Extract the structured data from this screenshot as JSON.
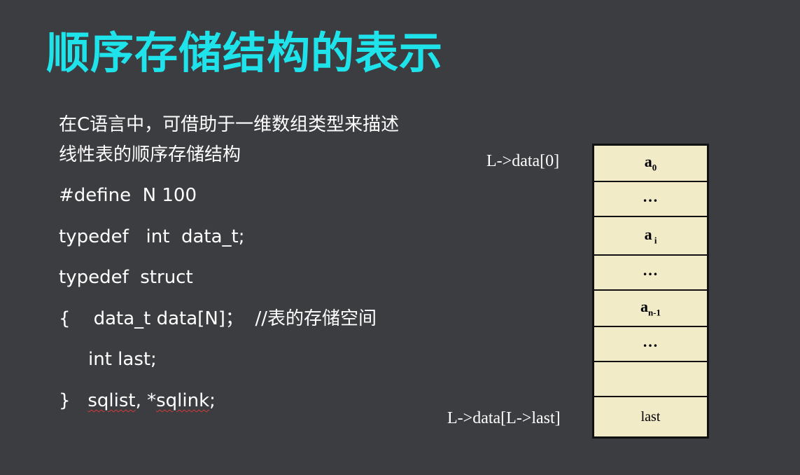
{
  "slide": {
    "title": "顺序存储结构的表示",
    "code_lines": [
      "在C语言中，可借助于一维数组类型来描述",
      "线性表的顺序存储结构",
      "#define  N 100",
      "typedef   int  data_t;",
      "typedef  struct",
      "{    data_t data[N]；  //表的存储空间",
      "int last;",
      "}"
    ],
    "last_line_tail": {
      "sep": "   ",
      "word1": "sqlist",
      "mid": ", *",
      "word2": "sqlink",
      "end": ";"
    }
  },
  "diagram": {
    "label_top": "L->data[0]",
    "label_bottom": "L->data[L->last]",
    "cells": [
      {
        "base": "a",
        "sub": "0"
      },
      {
        "text": "…"
      },
      {
        "base": "a",
        "sub": " i"
      },
      {
        "text": "…"
      },
      {
        "base": "a",
        "sub": "n-1"
      },
      {
        "text": "…"
      },
      {
        "text": ""
      },
      {
        "text": "last"
      }
    ]
  },
  "colors": {
    "background": "#3c3d41",
    "title": "#1ee3ea",
    "cell_fill": "#f1ebc8",
    "cell_border": "#111111"
  }
}
